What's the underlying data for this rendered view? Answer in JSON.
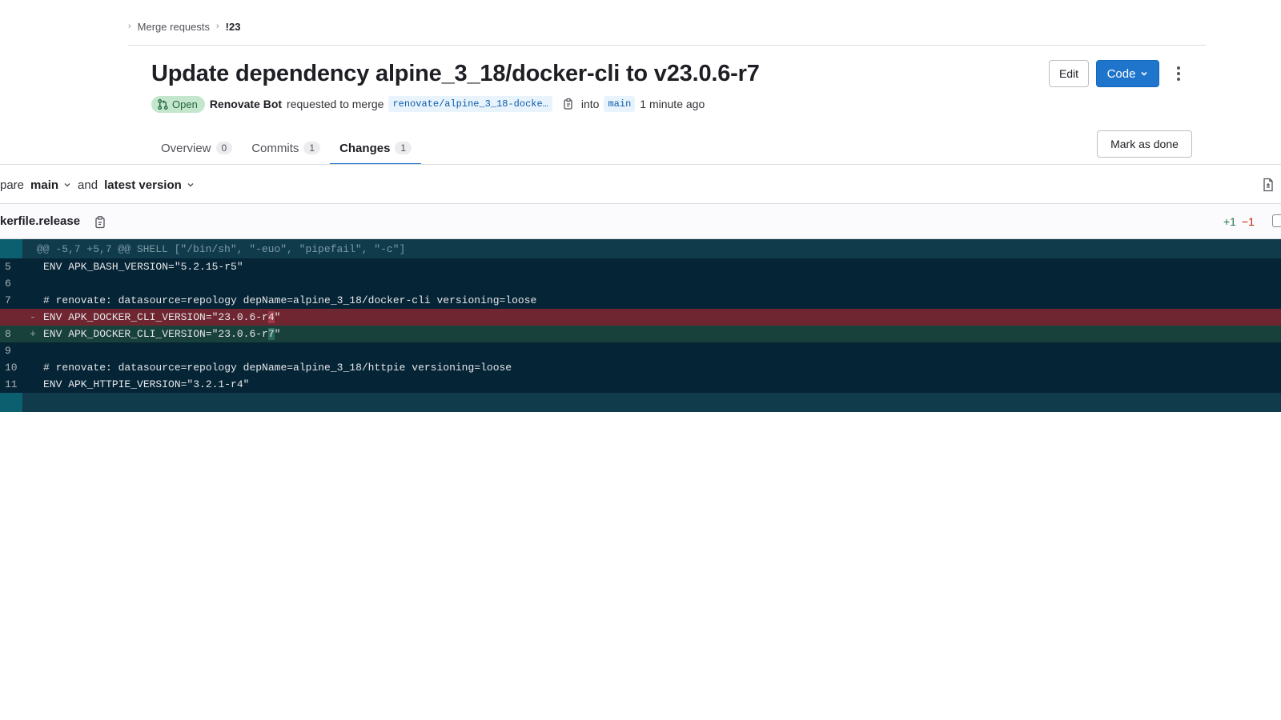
{
  "breadcrumb": {
    "items": [
      "Merge requests",
      "!23"
    ]
  },
  "mr": {
    "title": "Update dependency alpine_3_18/docker-cli to v23.0.6-r7",
    "status": "Open",
    "author": "Renovate Bot",
    "requested_text": "requested to merge",
    "source_branch": "renovate/alpine_3_18-docke…",
    "into_text": "into",
    "target_branch": "main",
    "time": "1 minute ago"
  },
  "actions": {
    "edit_label": "Edit",
    "code_label": "Code",
    "mark_done_label": "Mark as done"
  },
  "tabs": [
    {
      "label": "Overview",
      "count": "0",
      "active": false
    },
    {
      "label": "Commits",
      "count": "1",
      "active": false
    },
    {
      "label": "Changes",
      "count": "1",
      "active": true
    }
  ],
  "compare": {
    "prefix": "pare",
    "base": "main",
    "and_text": "and",
    "head": "latest version"
  },
  "file": {
    "name": "kerfile.release",
    "additions": "+1",
    "deletions": "−1"
  },
  "diff": {
    "hunk_header": "@@ -5,7 +5,7 @@ SHELL [\"/bin/sh\", \"-euo\", \"pipefail\", \"-c\"]",
    "lines": [
      {
        "num": "5",
        "sign": "",
        "text": "ENV APK_BASH_VERSION=\"5.2.15-r5\"",
        "type": "context"
      },
      {
        "num": "6",
        "sign": "",
        "text": "",
        "type": "context"
      },
      {
        "num": "7",
        "sign": "",
        "text": "# renovate: datasource=repology depName=alpine_3_18/docker-cli versioning=loose",
        "type": "context"
      },
      {
        "num": "",
        "sign": "-",
        "text_pre": "ENV APK_DOCKER_CLI_VERSION=\"23.0.6-r",
        "text_hl": "4",
        "text_post": "\"",
        "type": "del"
      },
      {
        "num": "8",
        "sign": "+",
        "text_pre": "ENV APK_DOCKER_CLI_VERSION=\"23.0.6-r",
        "text_hl": "7",
        "text_post": "\"",
        "type": "add"
      },
      {
        "num": "9",
        "sign": "",
        "text": "",
        "type": "context"
      },
      {
        "num": "10",
        "sign": "",
        "text": "# renovate: datasource=repology depName=alpine_3_18/httpie versioning=loose",
        "type": "context"
      },
      {
        "num": "11",
        "sign": "",
        "text": "ENV APK_HTTPIE_VERSION=\"3.2.1-r4\"",
        "type": "context"
      }
    ]
  },
  "colors": {
    "accent": "#1f75cb",
    "open_badge_bg": "#c3e6cd",
    "diff_bg": "#052436",
    "diff_del_bg": "#6f2631",
    "diff_add_bg": "#18413c"
  }
}
